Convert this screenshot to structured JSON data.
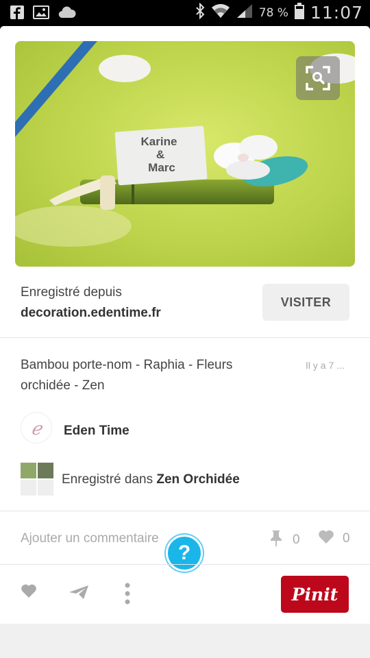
{
  "status_bar": {
    "battery_pct": "78 %",
    "time": "11:07",
    "left_icons": [
      "facebook-icon",
      "gallery-icon",
      "cloud-icon"
    ],
    "right_icons": [
      "bluetooth-icon",
      "wifi-icon",
      "signal-icon",
      "battery-icon"
    ]
  },
  "pin": {
    "image_caption_lines": [
      "Karine",
      "&",
      "Marc"
    ],
    "source_label": "Enregistré depuis",
    "source_domain": "decoration.edentime.fr",
    "visit_label": "VISITER",
    "description": "Bambou porte-nom - Raphia - Fleurs orchidée - Zen",
    "time_ago": "Il y a 7 ...",
    "author": "Eden Time",
    "board_prefix": "Enregistré dans",
    "board_name": "Zen Orchidée",
    "comment_placeholder": "Ajouter un commentaire",
    "repin_count": "0",
    "like_count": "0",
    "help_label": "?",
    "pinit_label": "Pinit"
  },
  "colors": {
    "pinit_red": "#bd081c",
    "help_blue": "#1ab6ea"
  }
}
